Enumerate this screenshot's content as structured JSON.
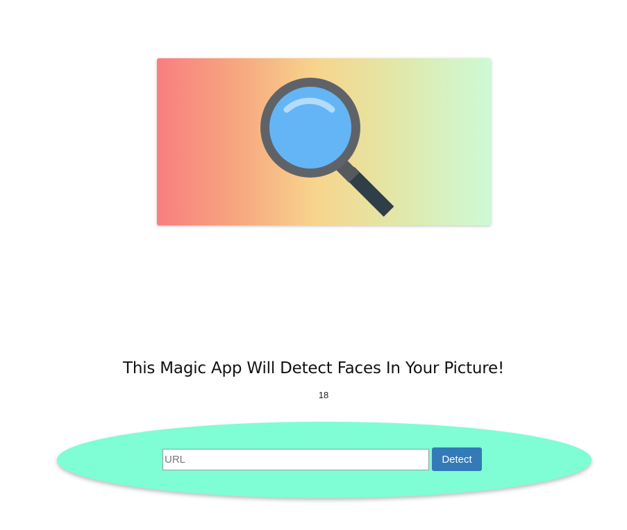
{
  "hero": {
    "icon": "magnifying-glass-icon"
  },
  "headline": "This Magic App Will Detect Faces In Your Picture!",
  "face_count": "18",
  "form": {
    "url_placeholder": "URL",
    "url_value": "",
    "detect_label": "Detect"
  },
  "colors": {
    "oval_background": "#7ffdd5",
    "button_background": "#337ab7",
    "gradient": [
      "#f87e80",
      "#f7d58d",
      "#cdfad6"
    ]
  }
}
